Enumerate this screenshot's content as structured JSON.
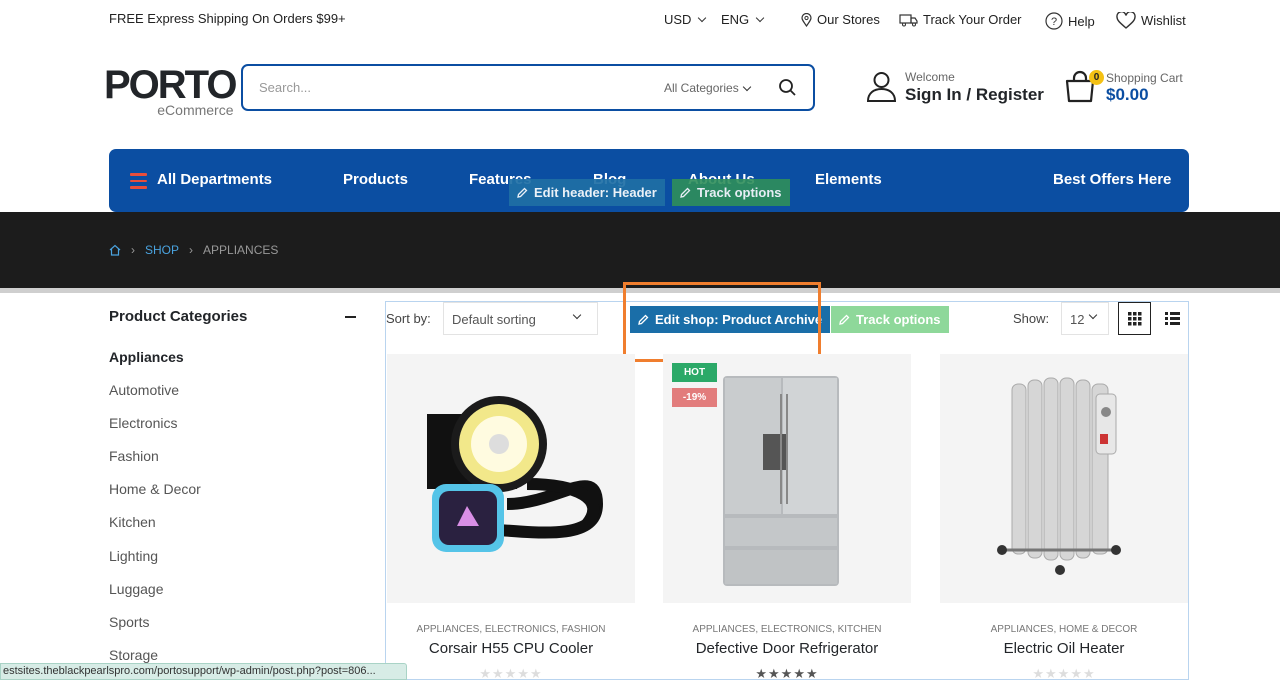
{
  "topbar": {
    "shipping": "FREE Express Shipping On Orders $99+",
    "currency": "USD",
    "language": "ENG",
    "our_stores": "Our Stores",
    "track_order": "Track Your Order",
    "help": "Help",
    "wishlist": "Wishlist"
  },
  "header": {
    "logo_main": "PORTO",
    "logo_sub": "eCommerce",
    "search_placeholder": "Search...",
    "search_category": "All Categories",
    "welcome": "Welcome",
    "sign_in": "Sign In",
    "slash": "/",
    "register": "Register",
    "cart_count": "0",
    "cart_label": "Shopping Cart",
    "cart_amount": "$0.00"
  },
  "nav": {
    "departments": "All Departments",
    "items": [
      "Products",
      "Features",
      "Blog",
      "About Us",
      "Elements"
    ],
    "offers": "Best Offers Here",
    "edit_header": "Edit header: Header",
    "track_options": "Track options"
  },
  "breadcrumb": {
    "shop": "SHOP",
    "current": "APPLIANCES"
  },
  "sidebar": {
    "title": "Product Categories",
    "categories": [
      "Appliances",
      "Automotive",
      "Electronics",
      "Fashion",
      "Home & Decor",
      "Kitchen",
      "Lighting",
      "Luggage",
      "Sports",
      "Storage"
    ]
  },
  "toolbar": {
    "sort_label": "Sort by:",
    "sort_value": "Default sorting",
    "edit_shop": "Edit shop: Product Archive",
    "track_options": "Track options",
    "show_label": "Show:",
    "show_value": "12"
  },
  "products": [
    {
      "categories": "APPLIANCES, ELECTRONICS, FASHION",
      "name": "Corsair H55 CPU Cooler",
      "stars": "★★★★★"
    },
    {
      "categories": "APPLIANCES, ELECTRONICS, KITCHEN",
      "name": "Defective Door Refrigerator",
      "stars": "★★★★★",
      "label_hot": "HOT",
      "label_sale": "-19%"
    },
    {
      "categories": "APPLIANCES, HOME & DECOR",
      "name": "Electric Oil Heater",
      "stars": "★★★★★"
    }
  ],
  "status_url": "estsites.theblackpearlspro.com/portosupport/wp-admin/post.php?post=806...",
  "colors": {
    "primary": "#0b4ea2",
    "accent": "#e94e3b",
    "dark_band": "#1c1c1c"
  }
}
